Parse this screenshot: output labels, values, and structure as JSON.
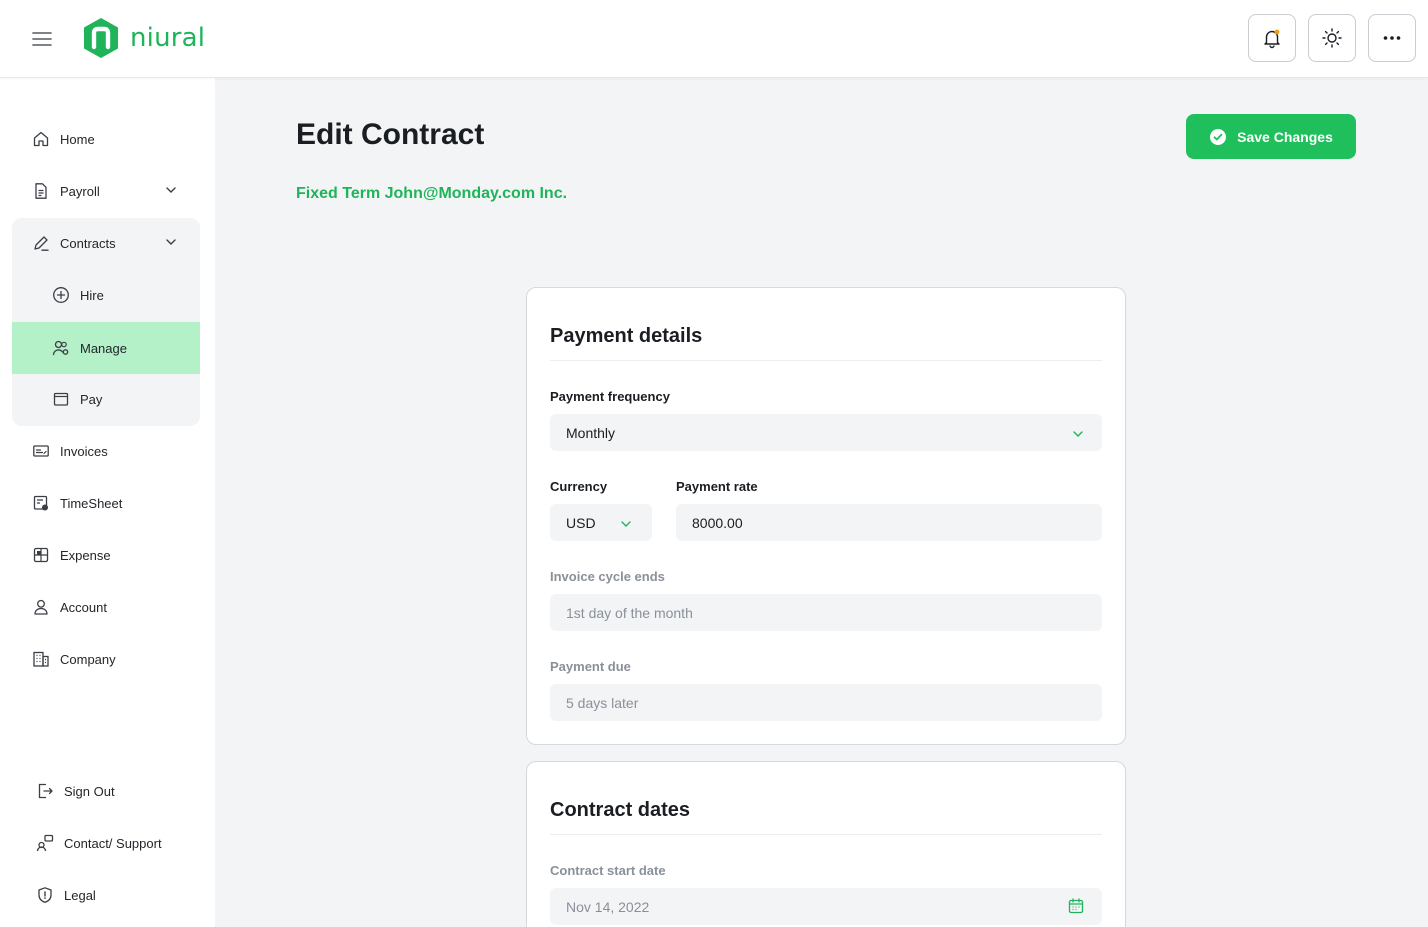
{
  "brand": {
    "name": "niural",
    "color": "#1fb45a"
  },
  "topbar": {
    "menu_icon": "hamburger-icon",
    "buttons": [
      {
        "name": "notifications",
        "icon": "bell-icon"
      },
      {
        "name": "theme",
        "icon": "sun-icon"
      },
      {
        "name": "more",
        "icon": "more-horizontal-icon"
      }
    ]
  },
  "sidebar": {
    "items": {
      "home": "Home",
      "payroll": "Payroll",
      "contracts": "Contracts",
      "hire": "Hire",
      "manage": "Manage",
      "pay": "Pay",
      "invoices": "Invoices",
      "timesheet": "TimeSheet",
      "expense": "Expense",
      "account": "Account",
      "company": "Company"
    },
    "bottom": {
      "sign_out": "Sign Out",
      "support": "Contact/ Support",
      "legal": "Legal"
    },
    "active_item": "Manage"
  },
  "main": {
    "title": "Edit Contract",
    "subtitle": "Fixed Term John@Monday.com Inc.",
    "save_label": "Save Changes"
  },
  "payment_details": {
    "title": "Payment details",
    "frequency_label": "Payment frequency",
    "frequency_value": "Monthly",
    "currency_label": "Currency",
    "currency_value": "USD",
    "rate_label": "Payment rate",
    "rate_value": "8000.00",
    "cycle_label": "Invoice cycle ends",
    "cycle_value": "1st day of the month",
    "due_label": "Payment due",
    "due_value": "5 days later"
  },
  "contract_dates": {
    "title": "Contract dates",
    "start_label": "Contract start date",
    "start_value": "Nov 14, 2022"
  },
  "colors": {
    "accent": "#1fbf5c",
    "active_nav": "#b4f0c8",
    "background": "#f3f4f6"
  }
}
